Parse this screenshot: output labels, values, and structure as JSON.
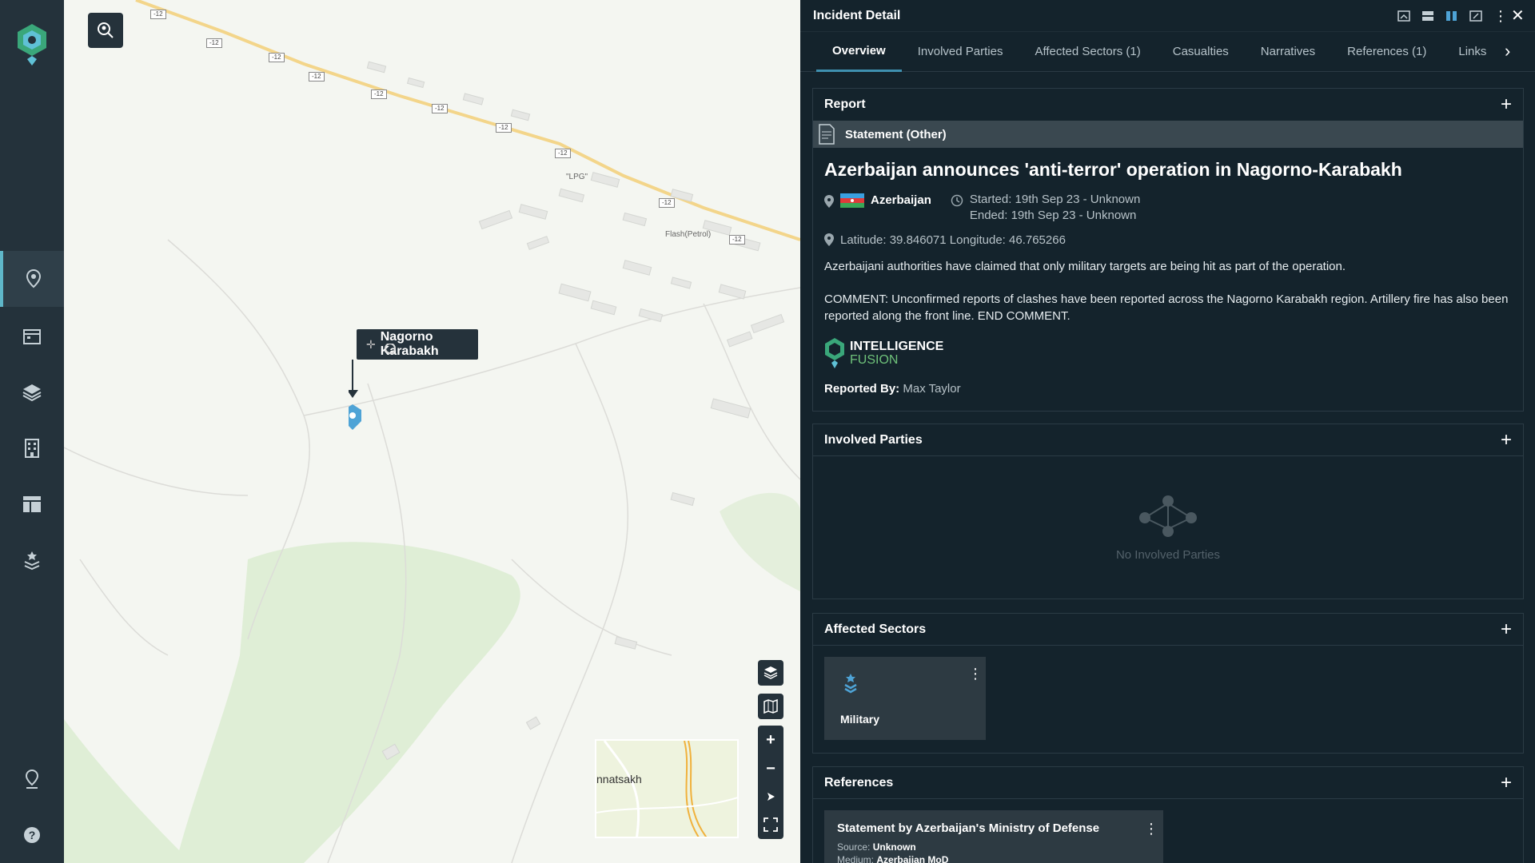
{
  "map": {
    "place_label": "Nagorno Karabakh",
    "road_tag": "-12",
    "poi_lpg": "\"LPG\"",
    "poi_flash": "Flash(Petrol)",
    "minimap_label": "nnatsakh"
  },
  "panel": {
    "title": "Incident Detail",
    "tabs": [
      {
        "label": "Overview"
      },
      {
        "label": "Involved Parties"
      },
      {
        "label": "Affected Sectors (1)"
      },
      {
        "label": "Casualties"
      },
      {
        "label": "Narratives"
      },
      {
        "label": "References (1)"
      },
      {
        "label": "Links"
      }
    ]
  },
  "report": {
    "section_title": "Report",
    "statement_label": "Statement (Other)",
    "headline": "Azerbaijan announces 'anti-terror' operation in Nagorno-Karabakh",
    "country": "Azerbaijan",
    "started": "Started: 19th Sep 23 - Unknown",
    "ended": "Ended: 19th Sep 23 - Unknown",
    "coords": "Latitude: 39.846071 Longitude: 46.765266",
    "para1": "Azerbaijani authorities have claimed that only military targets are being hit as part of the operation.",
    "para2": "COMMENT: Unconfirmed reports of clashes have been reported across the Nagorno Karabakh region. Artillery fire has also been reported along the front line. END COMMENT.",
    "brand_line1": "INTELLIGENCE",
    "brand_line2": "FUSION",
    "reported_by_label": "Reported By:",
    "reported_by": "Max Taylor"
  },
  "involved": {
    "section_title": "Involved Parties",
    "empty": "No Involved Parties"
  },
  "sectors": {
    "section_title": "Affected Sectors",
    "items": [
      {
        "name": "Military"
      }
    ]
  },
  "references": {
    "section_title": "References",
    "items": [
      {
        "title": "Statement by Azerbaijan's Ministry of Defense",
        "source_label": "Source:",
        "source": "Unknown",
        "medium_label": "Medium:",
        "medium": "Azerbaijan MoD"
      }
    ]
  },
  "colors": {
    "sidebar": "#24323b",
    "panel": "#14232c",
    "accent": "#3f90b0",
    "brand_green": "#6fc27a"
  }
}
